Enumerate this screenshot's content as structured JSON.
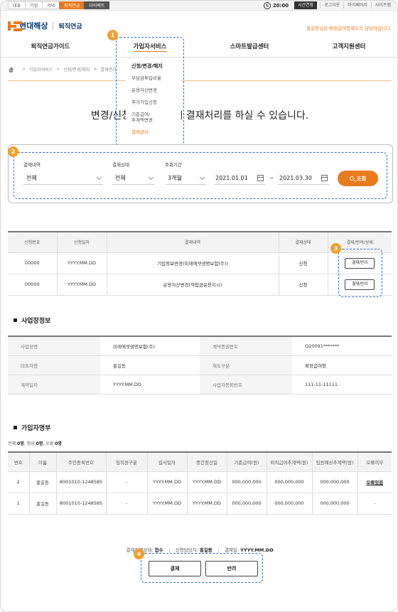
{
  "topbar": {
    "tabs": [
      "대표",
      "기업",
      "저녁",
      "퇴직연금",
      "다이렉트"
    ],
    "time": "20:00",
    "extend": "시간연장",
    "links": [
      "로그아웃",
      "마이페이지",
      "사이트맵"
    ]
  },
  "header": {
    "logo": "현대해상",
    "sub": "퇴직연금",
    "note": "홍길동님은 확정급여형제도의 담당자입니다."
  },
  "nav": [
    "퇴직연금가이드",
    "가입자서비스",
    "스마트발급센터",
    "고객지원센터"
  ],
  "breadcrumb": [
    "가입자서비스",
    "신청/변경/해지",
    "결재관리"
  ],
  "dropdown": [
    "신청/변경/해지",
    "부담금투입비율",
    "운용자산변경",
    "추가가입신청",
    "기준급여/\n추계액변경",
    "결재관리"
  ],
  "headline": "변경/신청 내역에 대해 결재처리를 하실 수 있습니다.",
  "badges": [
    "1",
    "2",
    "3",
    "4"
  ],
  "search": {
    "label1": "결재내역",
    "value1": "전체",
    "label2": "결재상태",
    "value2": "전체",
    "label3": "조회기간",
    "period": "3개월",
    "start": "2021.01.01",
    "end": "2021.03.30",
    "tilde": "~",
    "button": "조회"
  },
  "request_table": {
    "headers": [
      "신청번호",
      "신청일자",
      "결재내역",
      "결재상태",
      "결재/반려/상세"
    ],
    "rows": [
      [
        "00000",
        "YYYY.MM.DD",
        "기업정보변경(미래에셋생명보험(주))",
        "신청",
        "결재/반려"
      ],
      [
        "00000",
        "YYYY.MM.DD",
        "운용자산변경(적립금운용지시)",
        "신청",
        "결재/반려"
      ]
    ]
  },
  "company": {
    "title": "사업장정보",
    "rows": [
      [
        "사업장명",
        "미래에셋생명보험(주)",
        "계약증권번호",
        "Q20091*******"
      ],
      [
        "대표자명",
        "홍길동",
        "제도구분",
        "확정급여형"
      ],
      [
        "계약일자",
        "YYYY.MM.DD",
        "사업자등록번호",
        "111-11-11111"
      ]
    ]
  },
  "members": {
    "title": "가입자명부",
    "count": {
      "total_label": "전체:",
      "total": "0명",
      "normal_label": ", 정상:",
      "normal": "0명",
      "error_label": ", 오류:",
      "error": "0명"
    },
    "headers": [
      "번호",
      "이름",
      "주민등록번호",
      "임직원구분",
      "입사일자",
      "중간정산일",
      "기준급여(원)",
      "퇴직급여추계액(원)",
      "임원예상추계액(원)",
      "오류여부"
    ],
    "rows": [
      [
        "2",
        "홍길동",
        "8001010-1248585",
        "-",
        "YYYY.MM.DD",
        "YYYY.MM.DD",
        "000,000,000",
        "000,000,000",
        "000,000,000",
        "오류있음"
      ],
      [
        "1",
        "홍길동",
        "8001010-1248585",
        "-",
        "YYYY.MM.DD",
        "YYYY.MM.DD",
        "000,000,000",
        "000,000,000",
        "000,000,000",
        "-"
      ]
    ]
  },
  "status": {
    "state_label": "결재진행상태:",
    "state": "접수",
    "manager_label": "신청담당자:",
    "manager": "홍길동",
    "date_label": "결재일:",
    "date": "YYYY.MM.DD"
  },
  "actions": {
    "approve": "결재",
    "reject": "반려"
  },
  "colors": {
    "accent": "#e87b1e",
    "brand": "#0b3a78",
    "highlight": "#2f6fc9"
  }
}
